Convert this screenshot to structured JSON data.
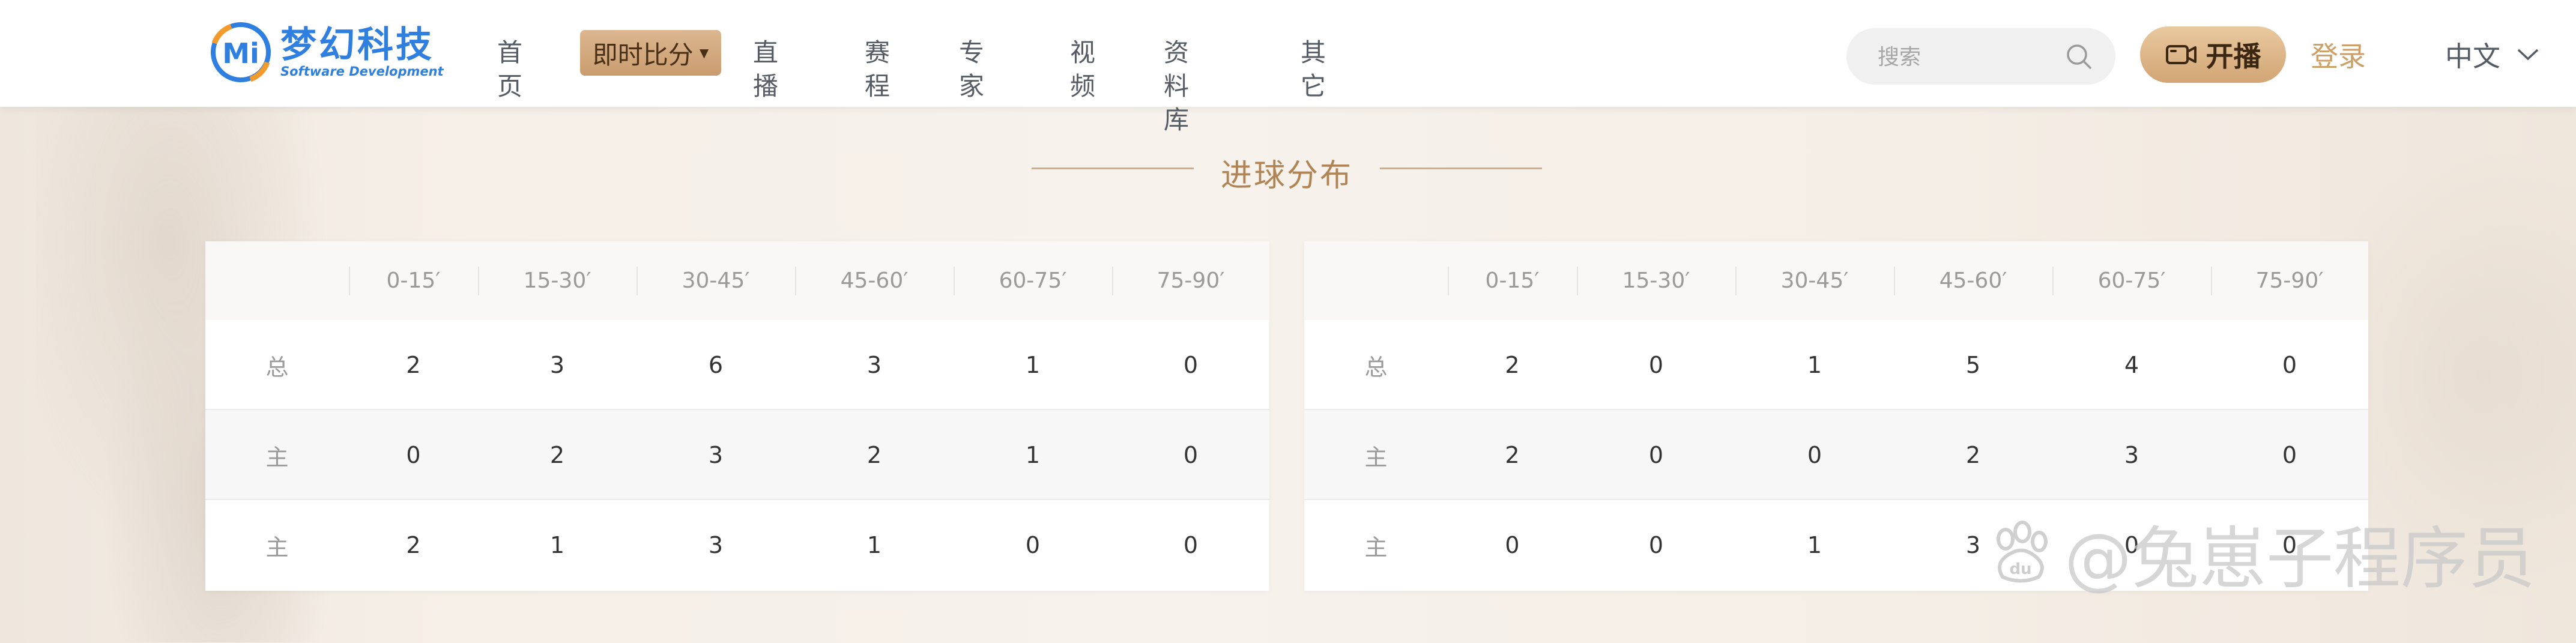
{
  "header": {
    "logo": {
      "title": "梦幻科技",
      "subtitle": "Software Development",
      "mark": "Mi"
    },
    "nav": [
      {
        "label": "首页"
      },
      {
        "label": "即时比分",
        "active": true
      },
      {
        "label": "直播"
      },
      {
        "label": "赛程"
      },
      {
        "label": "专家"
      },
      {
        "label": "视频"
      },
      {
        "label": "资料库"
      },
      {
        "label": "其它"
      }
    ],
    "search": {
      "placeholder": "搜索",
      "icon": "search-icon"
    },
    "live_button": {
      "label": "开播",
      "icon": "camera-icon"
    },
    "login": "登录",
    "language": {
      "selected": "中文",
      "icon": "chevron-down-icon"
    }
  },
  "section": {
    "title": "进球分布"
  },
  "tables": [
    {
      "headers": [
        "",
        "0-15′",
        "15-30′",
        "30-45′",
        "45-60′",
        "60-75′",
        "75-90′"
      ],
      "rows": [
        {
          "label": "总",
          "values": [
            "2",
            "3",
            "6",
            "3",
            "1",
            "0"
          ]
        },
        {
          "label": "主",
          "values": [
            "0",
            "2",
            "3",
            "2",
            "1",
            "0"
          ]
        },
        {
          "label": "主",
          "values": [
            "2",
            "1",
            "3",
            "1",
            "0",
            "0"
          ]
        }
      ]
    },
    {
      "headers": [
        "",
        "0-15′",
        "15-30′",
        "30-45′",
        "45-60′",
        "60-75′",
        "75-90′"
      ],
      "rows": [
        {
          "label": "总",
          "values": [
            "2",
            "0",
            "1",
            "5",
            "4",
            "0"
          ]
        },
        {
          "label": "主",
          "values": [
            "2",
            "0",
            "0",
            "2",
            "3",
            "0"
          ]
        },
        {
          "label": "主",
          "values": [
            "0",
            "0",
            "1",
            "3",
            "0",
            "0"
          ]
        }
      ]
    }
  ],
  "watermark": {
    "text": "@兔崽子程序员",
    "brand": "du"
  },
  "colors": {
    "accent": "#c99c6e",
    "brand_blue": "#2f7fe0",
    "title": "#b08455"
  }
}
